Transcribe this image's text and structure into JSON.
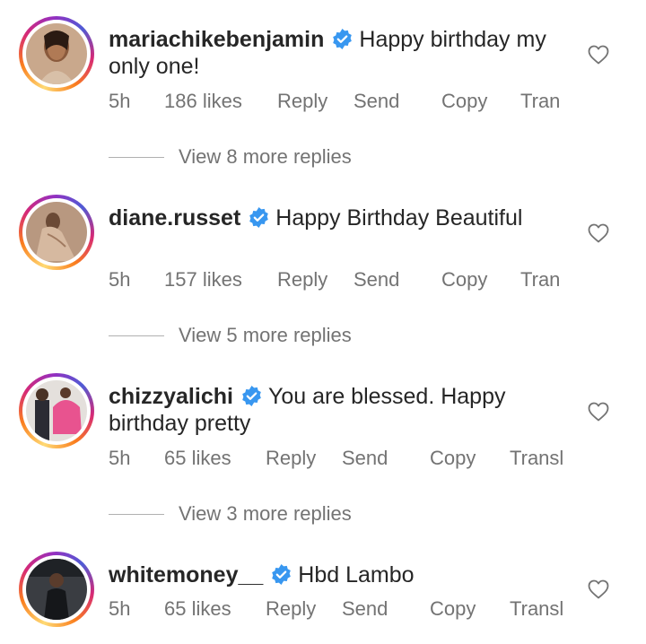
{
  "comments": [
    {
      "username": "mariachikebenjamin",
      "text": "Happy birthday my only one!",
      "time": "5h",
      "likes": "186 likes",
      "reply": "Reply",
      "send": "Send",
      "copy": "Copy",
      "translate": "Tran",
      "view_replies": "View 8 more replies"
    },
    {
      "username": "diane.russet",
      "text": "Happy Birthday Beautiful",
      "time": "5h",
      "likes": "157 likes",
      "reply": "Reply",
      "send": "Send",
      "copy": "Copy",
      "translate": "Tran",
      "view_replies": "View 5 more replies"
    },
    {
      "username": "chizzyalichi",
      "text": "You are blessed. Happy birthday pretty",
      "time": "5h",
      "likes": "65 likes",
      "reply": "Reply",
      "send": "Send",
      "copy": "Copy",
      "translate": "Transl",
      "view_replies": "View 3 more replies"
    },
    {
      "username": "whitemoney__",
      "text": "Hbd Lambo",
      "time": "5h",
      "likes": "65 likes",
      "reply": "Reply",
      "send": "Send",
      "copy": "Copy",
      "translate": "Transl"
    }
  ],
  "colors": {
    "verified_blue": "#3897f0",
    "meta_gray": "#737373",
    "text": "#262626"
  },
  "icons": {
    "verified": "verified-badge-icon",
    "like": "heart-outline-icon"
  }
}
